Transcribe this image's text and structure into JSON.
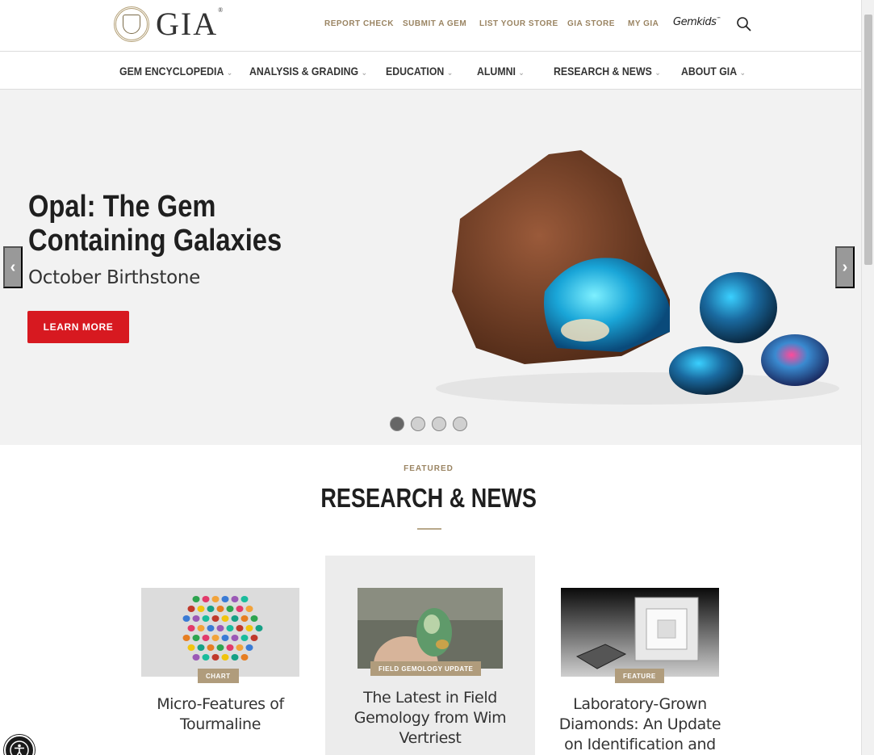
{
  "brand": {
    "name": "GIA",
    "reg_mark": "®"
  },
  "util_nav": [
    {
      "label": "REPORT CHECK"
    },
    {
      "label": "SUBMIT A GEM"
    },
    {
      "label": "LIST YOUR STORE"
    },
    {
      "label": "GIA STORE"
    },
    {
      "label": "MY GIA"
    }
  ],
  "gemkids": {
    "label": "Gemkids",
    "tm": "™"
  },
  "search": {
    "icon": "search-icon"
  },
  "main_nav": [
    {
      "label": "GEM ENCYCLOPEDIA"
    },
    {
      "label": "ANALYSIS & GRADING"
    },
    {
      "label": "EDUCATION"
    },
    {
      "label": "ALUMNI"
    },
    {
      "label": "RESEARCH & NEWS"
    },
    {
      "label": "ABOUT GIA"
    }
  ],
  "nav_chevron": "⌄",
  "hero": {
    "title": "Opal: The Gem Containing Galaxies",
    "subtitle": "October Birthstone",
    "button": "LEARN MORE",
    "prev": "‹",
    "next": "›",
    "slide_count": 4,
    "active_slide": 1,
    "colors": {
      "button": "#d71920"
    }
  },
  "featured": {
    "kicker": "FEATURED",
    "title": "RESEARCH & NEWS"
  },
  "cards": [
    {
      "tag": "CHART",
      "title": "Micro-Features of Tourmaline"
    },
    {
      "tag": "FIELD GEMOLOGY UPDATE",
      "title": "The Latest in Field Gemology from Wim Vertriest"
    },
    {
      "tag": "FEATURE",
      "title": "Laboratory-Grown Diamonds: An Update on Identification and"
    }
  ],
  "colors": {
    "accent_gold": "#9a8462",
    "tag_bg": "#b09c7c"
  }
}
